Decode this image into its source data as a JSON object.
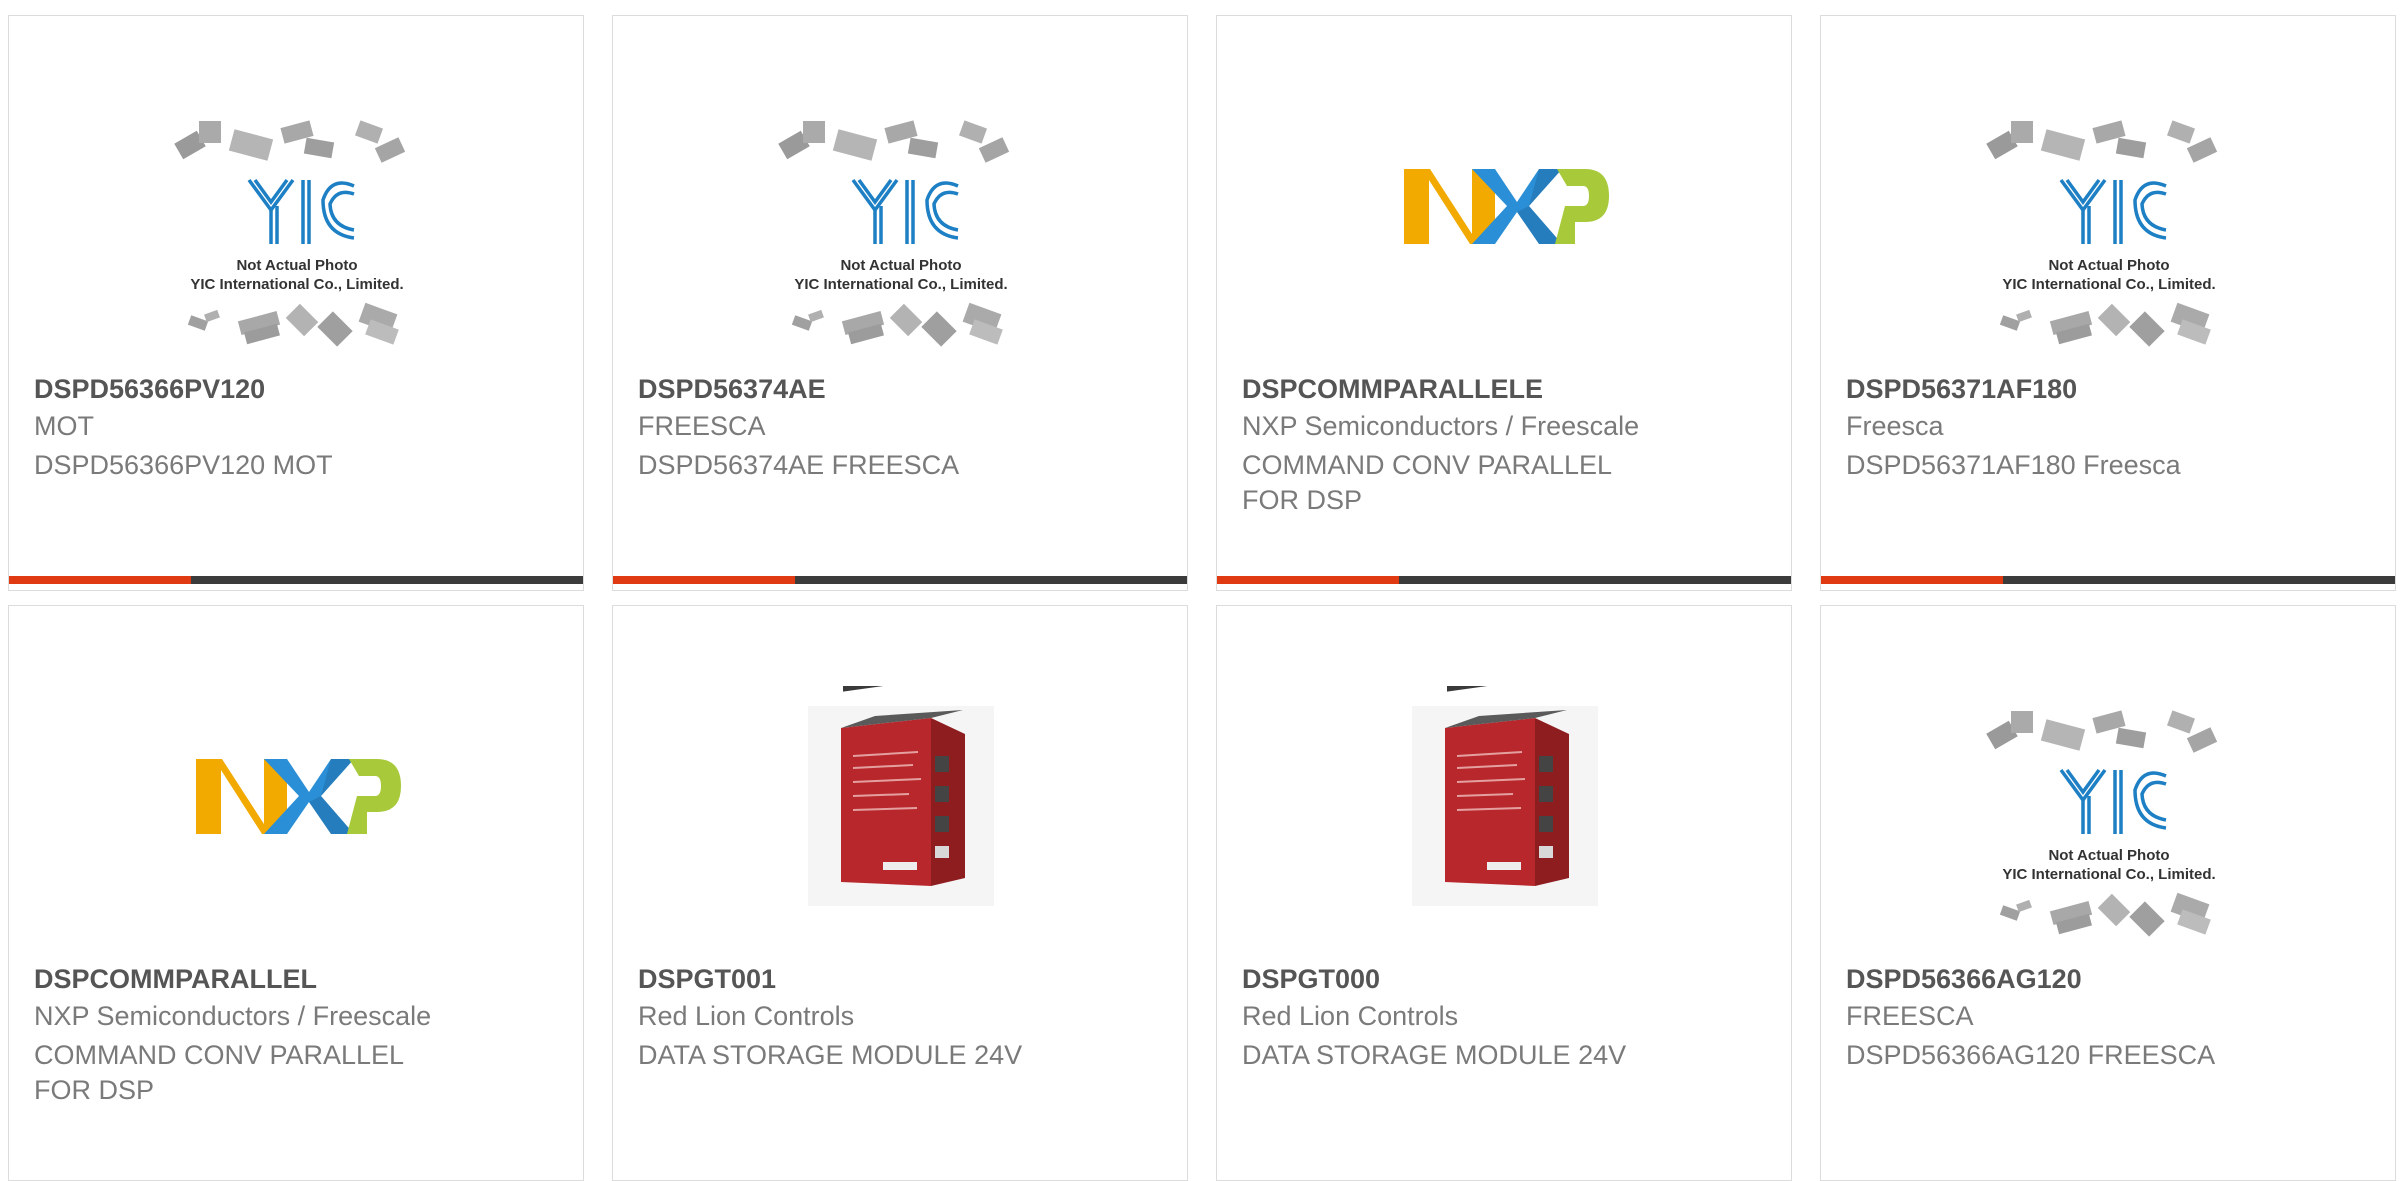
{
  "cards": [
    {
      "name": "DSPD56366PV120",
      "manufacturer": "MOT",
      "description": "DSPD56366PV120 MOT",
      "image": {
        "type": "yic-placeholder",
        "caption_line1": "Not Actual Photo",
        "caption_line2": "YIC International Co., Limited.",
        "logo": "YIC"
      }
    },
    {
      "name": "DSPD56374AE",
      "manufacturer": "FREESCA",
      "description": "DSPD56374AE FREESCA",
      "image": {
        "type": "yic-placeholder",
        "caption_line1": "Not Actual Photo",
        "caption_line2": "YIC International Co., Limited.",
        "logo": "YIC"
      }
    },
    {
      "name": "DSPCOMMPARALLELE",
      "manufacturer": "NXP Semiconductors / Freescale",
      "description": "COMMAND CONV PARALLEL FOR DSP",
      "image": {
        "type": "nxp-logo",
        "logo": "NXP"
      }
    },
    {
      "name": "DSPD56371AF180",
      "manufacturer": "Freesca",
      "description": "DSPD56371AF180 Freesca",
      "image": {
        "type": "yic-placeholder",
        "caption_line1": "Not Actual Photo",
        "caption_line2": "YIC International Co., Limited.",
        "logo": "YIC"
      }
    },
    {
      "name": "DSPCOMMPARALLEL",
      "manufacturer": "NXP Semiconductors / Freescale",
      "description": "COMMAND CONV PARALLEL FOR DSP",
      "image": {
        "type": "nxp-logo",
        "logo": "NXP"
      }
    },
    {
      "name": "DSPGT001",
      "manufacturer": "Red Lion Controls",
      "description": "DATA STORAGE MODULE 24V",
      "image": {
        "type": "product-photo",
        "icon": "red-module-icon"
      }
    },
    {
      "name": "DSPGT000",
      "manufacturer": "Red Lion Controls",
      "description": "DATA STORAGE MODULE 24V",
      "image": {
        "type": "product-photo",
        "icon": "red-module-icon"
      }
    },
    {
      "name": "DSPD56366AG120",
      "manufacturer": "FREESCA",
      "description": "DSPD56366AG120 FREESCA",
      "image": {
        "type": "yic-placeholder",
        "caption_line1": "Not Actual Photo",
        "caption_line2": "YIC International Co., Limited.",
        "logo": "YIC"
      }
    }
  ],
  "colors": {
    "accent": "#e03a13",
    "bar": "#3b3b3b",
    "title": "#555555",
    "text": "#7a7a7a",
    "border": "#dcdcdc"
  }
}
